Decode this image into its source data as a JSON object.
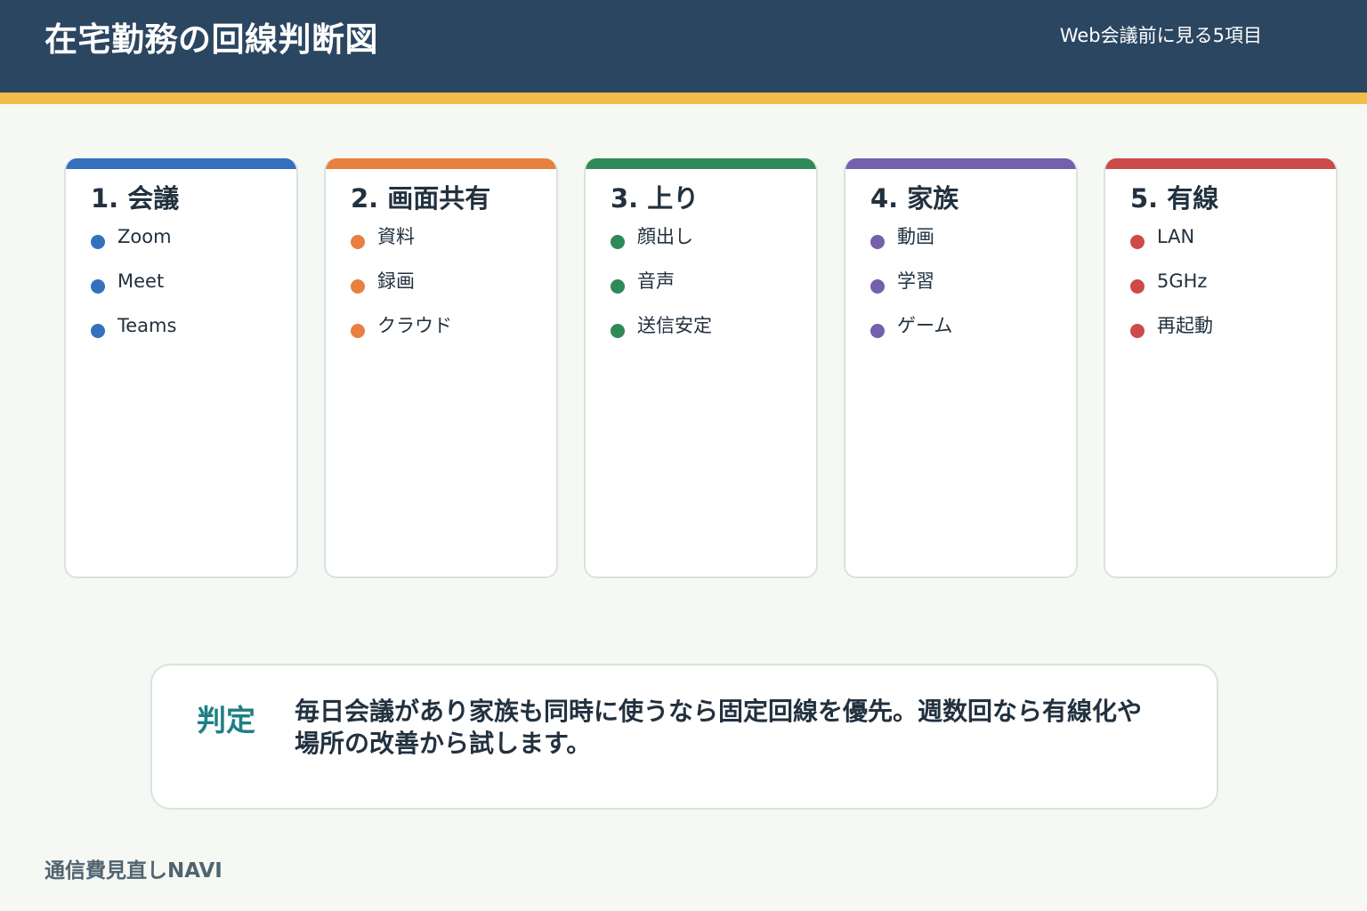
{
  "header": {
    "title": "在宅勤務の回線判断図",
    "subtitle": "Web会議前に見る5項目"
  },
  "cards": [
    {
      "heading": "1. 会議",
      "color": "#3570bf",
      "items": [
        "Zoom",
        "Meet",
        "Teams"
      ]
    },
    {
      "heading": "2. 画面共有",
      "color": "#e8803f",
      "items": [
        "資料",
        "録画",
        "クラウド"
      ]
    },
    {
      "heading": "3. 上り",
      "color": "#2f8a58",
      "items": [
        "顔出し",
        "音声",
        "送信安定"
      ]
    },
    {
      "heading": "4. 家族",
      "color": "#7460ab",
      "items": [
        "動画",
        "学習",
        "ゲーム"
      ]
    },
    {
      "heading": "5. 有線",
      "color": "#cc4a4a",
      "items": [
        "LAN",
        "5GHz",
        "再起動"
      ]
    }
  ],
  "verdict": {
    "label": "判定",
    "text": "毎日会議があり家族も同時に使うなら固定回線を優先。週数回なら有線化や場所の改善から試します。"
  },
  "footer": {
    "brand": "通信費見直しNAVI"
  },
  "colors": {
    "header_bg": "#2b4661",
    "header_stripe": "#f2bd4b",
    "verdict_label": "#1d7f86",
    "page_bg": "#f6f8f4"
  }
}
